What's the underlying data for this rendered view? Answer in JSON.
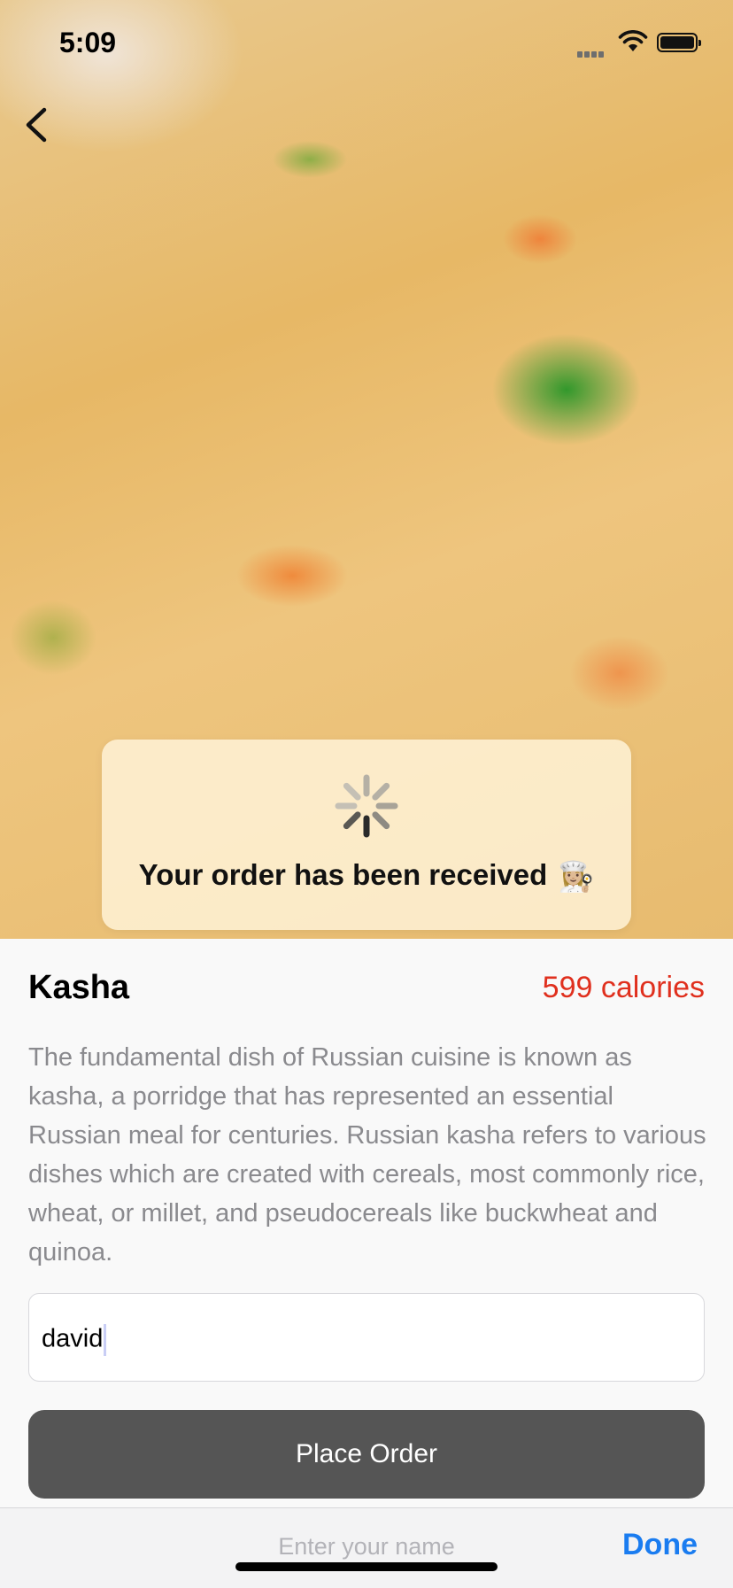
{
  "status_bar": {
    "time": "5:09"
  },
  "toast": {
    "message": "Your order has been received",
    "emoji": "👩🏼‍🍳"
  },
  "dish": {
    "name": "Kasha",
    "calories": "599 calories",
    "description": "The fundamental dish of Russian cuisine is known as kasha, a porridge that has represented an essential Russian meal for centuries. Russian kasha refers to various dishes which are created with cereals, most commonly rice, wheat, or millet, and pseudocereals like buckwheat and quinoa."
  },
  "order_form": {
    "name_value": "david",
    "button_label": "Place Order"
  },
  "keyboard_toolbar": {
    "placeholder": "Enter your name",
    "done_label": "Done"
  },
  "colors": {
    "calories": "#e0301e",
    "done": "#1a7cf0",
    "button": "#555555"
  }
}
